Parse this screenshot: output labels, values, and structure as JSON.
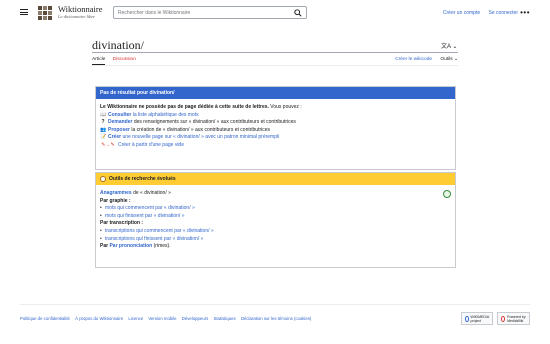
{
  "header": {
    "brand_title": "Wiktionnaire",
    "brand_tagline": "Le dictionnaire libre",
    "search_placeholder": "Rechercher dans le Wiktionnaire",
    "create_account": "Créer un compte",
    "login": "Se connecter",
    "more": "•••"
  },
  "page": {
    "title": "divination/",
    "lang_icon": "文A ⌄",
    "tabs": [
      "Article",
      "Discussion"
    ],
    "right_tabs": {
      "create_wikicode": "Créer le wikicode",
      "tools": "Outils ⌄"
    }
  },
  "no_result": {
    "heading": "Pas de résultat pour divination/",
    "intro_bold": "Le Wiktionnaire ne possède pas de page dédiée à cette suite de lettres.",
    "intro_rest": " Vous pouvez :",
    "items": [
      {
        "icon": "book-search-icon",
        "bold": "Consulter",
        "rest": " la liste alphabétique des mots"
      },
      {
        "icon": "question-icon",
        "bold": "Demander",
        "rest": " des renseignements sur « divination/ » aux contributeurs et contributrices"
      },
      {
        "icon": "people-icon",
        "bold": "Proposer",
        "rest": " la création de « divination/ » aux contributeurs et contributrices"
      },
      {
        "icon": "template-icon",
        "bold": "Créer",
        "rest": " une nouvelle page sur « divination/ » avec un patron minimal prérempli"
      },
      {
        "icon": "pencil-arrow-icon",
        "bold": "",
        "rest": "Créer à partir d'une page vide"
      }
    ]
  },
  "advanced": {
    "heading": "Outils de recherche évolués",
    "anagrams_bold": "Anagrammes",
    "anagrams_rest": " de « divination/ »",
    "by_spelling": "Par graphie :",
    "spelling_items": [
      "mots qui commencent par « divination/ »",
      "mots qui finissent par « divination/ »"
    ],
    "by_transcription": "Par transcription :",
    "transcription_items": [
      "transcriptions qui commencent par « divination/ »",
      "transcriptions qui finissent par « divination/ »"
    ],
    "by_pron_link": "Par prononciation",
    "by_pron_rest": " (rimes)."
  },
  "footer": {
    "links": [
      "Politique de confidentialité",
      "À propos du Wiktionnaire",
      "Licence",
      "Version mobile",
      "Développeurs",
      "Statistiques",
      "Déclaration sur les témoins (cookies)"
    ],
    "badge1": "WIKIMEDIA project",
    "badge2": "Powered by MediaWiki"
  },
  "colors": {
    "link": "#3366cc",
    "blue_header": "#3366cc",
    "yellow_header": "#ffcc33",
    "red_link": "#d73333"
  }
}
